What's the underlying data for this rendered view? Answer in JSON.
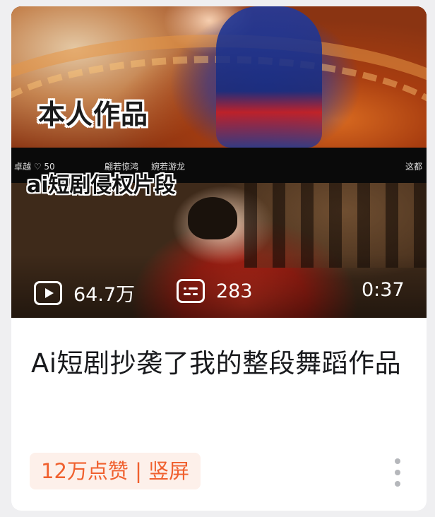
{
  "thumbnail": {
    "overlay_top_text": "本人作品",
    "overlay_mid_text": "ai短剧侵权片段",
    "strip_meta_left": "卓越 ♡ 50",
    "strip_meta_center_1": "翩若惊鸿",
    "strip_meta_center_2": "婉若游龙",
    "strip_meta_right": "这都",
    "view_icon": "play-icon",
    "views": "64.7万",
    "danmaku_icon": "danmaku-icon",
    "danmaku_count": "283",
    "duration": "0:37"
  },
  "video": {
    "title": "Ai短剧抄袭了我的整段舞蹈作品",
    "tag": "12万点赞 | 竖屏"
  },
  "colors": {
    "tag_text": "#f0602e",
    "tag_bg": "#fdf0ea",
    "title_text": "#18191c"
  }
}
